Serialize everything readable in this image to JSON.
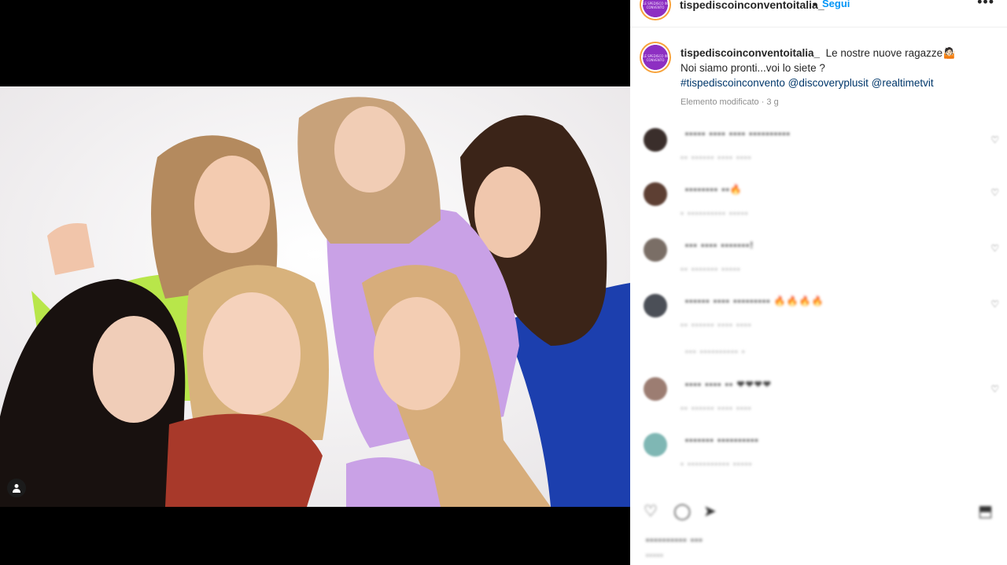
{
  "post": {
    "username": "tispediscoinconventoitalia_",
    "separator": "•",
    "follow_label": "Segui",
    "more_label": "•••",
    "avatar_mini_text": "LE SPEDISCO IN CONVENTO",
    "caption_line1": "Le nostre nuove ragazze🤷🏻",
    "caption_line2": "Noi siamo pronti...voi lo siete ?",
    "hashtag": "#tispediscoinconvento",
    "mention1": "@discoveryplusit",
    "mention2": "@realtimetvit",
    "edited_meta": "Elemento modificato · 3 g"
  },
  "comments": [
    {
      "text": "▪▪▪▪▪ ▪▪▪▪ ▪▪▪▪ ▪▪▪▪▪▪▪▪▪▪",
      "meta": "▪▪ ▪▪▪▪▪▪ ▪▪▪▪ ▪▪▪▪",
      "avatar_color": "#3a2e2b",
      "heart": "♡"
    },
    {
      "text": "▪▪▪▪▪▪▪▪ ▪▪🔥",
      "meta": "▪ ▪▪▪▪▪▪▪▪▪▪ ▪▪▪▪▪",
      "avatar_color": "#5d3f33",
      "heart": "♡"
    },
    {
      "text": "▪▪▪ ▪▪▪▪ ▪▪▪▪▪▪▪!",
      "meta": "▪▪ ▪▪▪▪▪▪▪ ▪▪▪▪▪",
      "avatar_color": "#7a6e66",
      "heart": "♡"
    },
    {
      "text": "▪▪▪▪▪▪ ▪▪▪▪ ▪▪▪▪▪▪▪▪▪ 🔥🔥🔥🔥",
      "meta": "▪▪ ▪▪▪▪▪▪ ▪▪▪▪ ▪▪▪▪",
      "sub": "▪▪▪ ▪▪▪▪▪▪▪▪▪▪ ▪",
      "avatar_color": "#4b4f57",
      "heart": "♡"
    },
    {
      "text": "▪▪▪▪ ▪▪▪▪ ▪▪ ❤❤❤❤",
      "meta": "▪▪ ▪▪▪▪▪▪ ▪▪▪▪ ▪▪▪▪",
      "avatar_color": "#9c7d72",
      "heart": "♡"
    },
    {
      "text": "▪▪▪▪▪▪▪ ▪▪▪▪▪▪▪▪▪▪",
      "meta": "▪ ▪▪▪▪▪▪▪▪▪▪▪ ▪▪▪▪▪",
      "avatar_color": "#7fb7b4",
      "heart": ""
    }
  ],
  "actions": {
    "like": "♡",
    "comment": "◯",
    "share": "➤",
    "save": "⬒"
  },
  "footer": {
    "likes": "▪▪▪▪▪▪▪▪▪▪ ▪▪▪",
    "date": "▪▪▪▪▪"
  },
  "colors": {
    "accent_blue": "#0095f6",
    "link_blue": "#00376b",
    "avatar_purple": "#8d2fc2"
  },
  "icons": {
    "tagged_user": "person-icon"
  }
}
